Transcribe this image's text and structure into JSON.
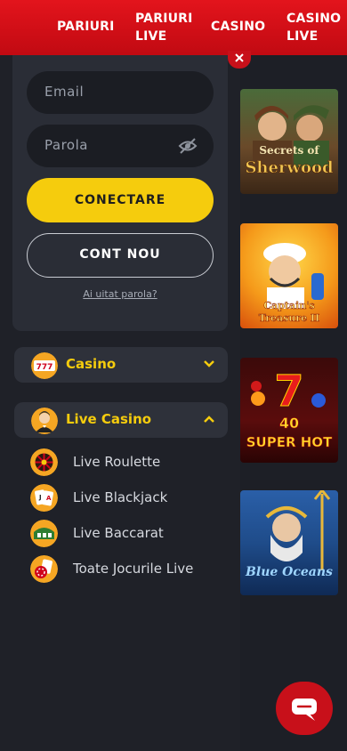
{
  "nav": {
    "items": [
      {
        "label_line1": "PARIURI",
        "label_line2": ""
      },
      {
        "label_line1": "PARIURI",
        "label_line2": "LIVE"
      },
      {
        "label_line1": "CASINO",
        "label_line2": ""
      },
      {
        "label_line1": "CASINO",
        "label_line2": "LIVE"
      }
    ]
  },
  "login": {
    "email_placeholder": "Email",
    "password_placeholder": "Parola",
    "login_label": "CONECTARE",
    "register_label": "CONT NOU",
    "forgot_label": "Ai uitat parola?"
  },
  "menu": {
    "casino_label": "Casino",
    "live_casino_label": "Live Casino",
    "live_items": [
      {
        "label": "Live Roulette"
      },
      {
        "label": "Live Blackjack"
      },
      {
        "label": "Live Baccarat"
      },
      {
        "label": "Toate Jocurile Live"
      }
    ]
  },
  "games": [
    {
      "title_line1": "Secrets of",
      "title_line2": "Sherwood"
    },
    {
      "title_line1": "Captain's",
      "title_line2": "Treasure II"
    },
    {
      "title_line1": "40",
      "title_line2": "SUPER HOT"
    },
    {
      "title_line1": "Blue",
      "title_line2": "Oceans"
    }
  ],
  "colors": {
    "brand_red": "#e3141c",
    "accent_yellow": "#f5cc0d",
    "drawer_bg": "#1f2128",
    "card_bg": "#2a2d36"
  }
}
